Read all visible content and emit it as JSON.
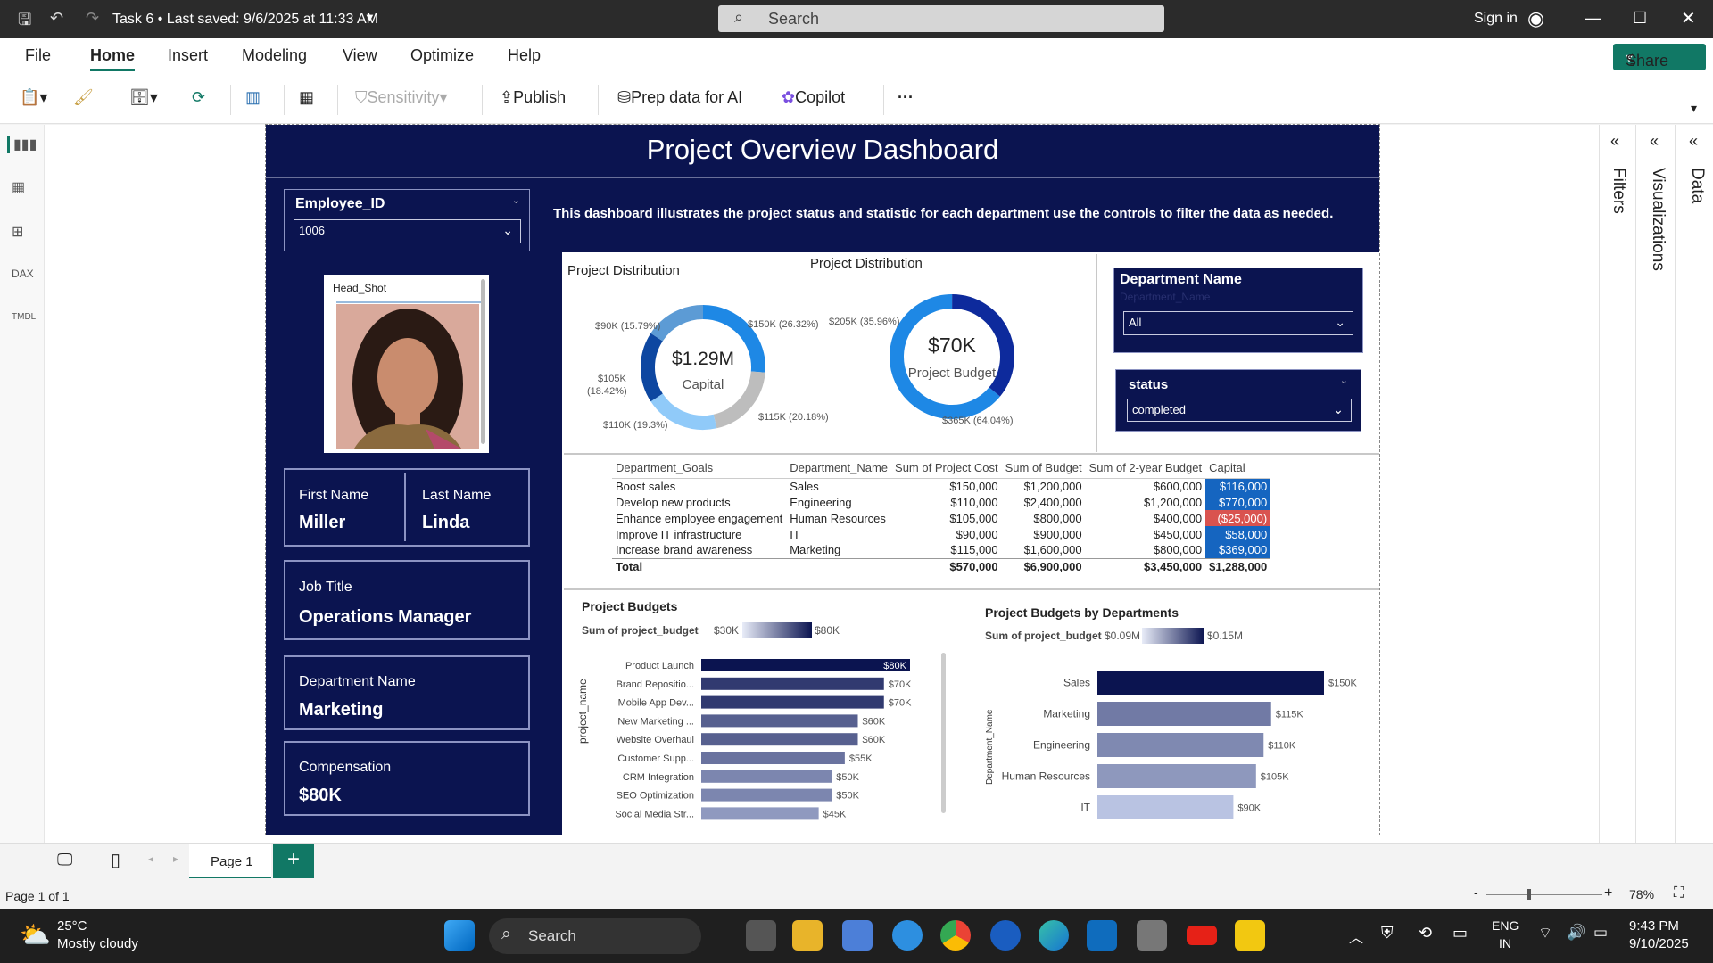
{
  "titlebar": {
    "doc": "Task 6 • Last saved: 9/6/2025 at 11:33 AM",
    "search": "Search",
    "signin": "Sign in"
  },
  "menu": {
    "file": "File",
    "home": "Home",
    "insert": "Insert",
    "modeling": "Modeling",
    "view": "View",
    "optimize": "Optimize",
    "help": "Help",
    "share": "Share"
  },
  "ribbon": {
    "sensitivity": "Sensitivity",
    "publish": "Publish",
    "prep": "Prep data for AI",
    "copilot": "Copilot",
    "more": "···"
  },
  "panes": {
    "filters": "Filters",
    "visualizations": "Visualizations",
    "data": "Data"
  },
  "dashboard": {
    "title": "Project Overview Dashboard",
    "description": "This dashboard illustrates the project status and statistic for each department use the controls to filter the data as needed.",
    "employee_slicer": {
      "label": "Employee_ID",
      "value": "1006"
    },
    "headshot_label": "Head_Shot",
    "first_name": {
      "label": "First Name",
      "value": "Miller"
    },
    "last_name": {
      "label": "Last Name",
      "value": "Linda"
    },
    "job_title": {
      "label": "Job Title",
      "value": "Operations Manager"
    },
    "department": {
      "label": "Department Name",
      "value": "Marketing"
    },
    "compensation": {
      "label": "Compensation",
      "value": "$80K"
    },
    "dept_slicer": {
      "label": "Department Name",
      "placeholder": "Department_Name",
      "value": "All"
    },
    "status_slicer": {
      "label": "status",
      "value": "completed"
    },
    "donut1": {
      "title": "Project Distribution",
      "center_value": "$1.29M",
      "center_label": "Capital"
    },
    "donut2": {
      "title": "Project Distribution",
      "center_value": "$70K",
      "center_label": "Project Budget"
    },
    "table": {
      "headers": [
        "Department_Goals",
        "Department_Name",
        "Sum of Project Cost",
        "Sum of Budget",
        "Sum of 2-year Budget",
        "Capital"
      ],
      "rows": [
        [
          "Boost sales",
          "Sales",
          "$150,000",
          "$1,200,000",
          "$600,000",
          "$116,000"
        ],
        [
          "Develop new products",
          "Engineering",
          "$110,000",
          "$2,400,000",
          "$1,200,000",
          "$770,000"
        ],
        [
          "Enhance employee engagement",
          "Human Resources",
          "$105,000",
          "$800,000",
          "$400,000",
          "($25,000)"
        ],
        [
          "Improve IT infrastructure",
          "IT",
          "$90,000",
          "$900,000",
          "$450,000",
          "$58,000"
        ],
        [
          "Increase brand awareness",
          "Marketing",
          "$115,000",
          "$1,600,000",
          "$800,000",
          "$369,000"
        ]
      ],
      "total": [
        "Total",
        "",
        "$570,000",
        "$6,900,000",
        "$3,450,000",
        "$1,288,000"
      ]
    },
    "bar1": {
      "title": "Project Budgets",
      "legend_label": "Sum of project_budget",
      "legend_min": "$30K",
      "legend_max": "$80K",
      "ylabel": "project_name"
    },
    "bar2": {
      "title": "Project Budgets by Departments",
      "legend_label": "Sum of project_budget",
      "legend_min": "$0.09M",
      "legend_max": "$0.15M",
      "ylabel": "Department_Name"
    }
  },
  "chart_data": [
    {
      "type": "pie",
      "title": "Project Distribution",
      "center": "$1.29M Capital",
      "labels": [
        "$150K (26.32%)",
        "$115K (20.18%)",
        "$110K (19.3%)",
        "$105K (18.42%)",
        "$90K (15.79%)"
      ],
      "values": [
        150,
        115,
        110,
        105,
        90
      ],
      "colors": [
        "#1e88e5",
        "#bdbdbd",
        "#90caf9",
        "#0d47a1",
        "#5c9bd5"
      ]
    },
    {
      "type": "pie",
      "title": "Project Distribution",
      "center": "$70K Project Budget",
      "labels": [
        "$365K (64.04%)",
        "$205K (35.96%)"
      ],
      "values": [
        365,
        205
      ],
      "colors": [
        "#1e88e5",
        "#0d2a9c"
      ]
    },
    {
      "type": "bar",
      "title": "Project Budgets",
      "ylabel": "project_name",
      "categories": [
        "Product Launch",
        "Brand Repositio...",
        "Mobile App Dev...",
        "New Marketing ...",
        "Website Overhaul",
        "Customer Supp...",
        "CRM Integration",
        "SEO Optimization",
        "Social Media Str..."
      ],
      "values": [
        80,
        70,
        70,
        60,
        60,
        55,
        50,
        50,
        45
      ],
      "labels": [
        "$80K",
        "$70K",
        "$70K",
        "$60K",
        "$60K",
        "$55K",
        "$50K",
        "$50K",
        "$45K"
      ]
    },
    {
      "type": "bar",
      "title": "Project Budgets by Departments",
      "ylabel": "Department_Name",
      "categories": [
        "Sales",
        "Marketing",
        "Engineering",
        "Human Resources",
        "IT"
      ],
      "values": [
        150,
        115,
        110,
        105,
        90
      ],
      "labels": [
        "$150K",
        "$115K",
        "$110K",
        "$105K",
        "$90K"
      ]
    }
  ],
  "bottom": {
    "page_tab": "Page 1",
    "page_info": "Page 1 of 1",
    "zoom": "78%"
  },
  "taskbar": {
    "temp": "25°C",
    "weather": "Mostly cloudy",
    "search": "Search",
    "lang1": "ENG",
    "lang2": "IN",
    "time": "9:43 PM",
    "date": "9/10/2025"
  }
}
